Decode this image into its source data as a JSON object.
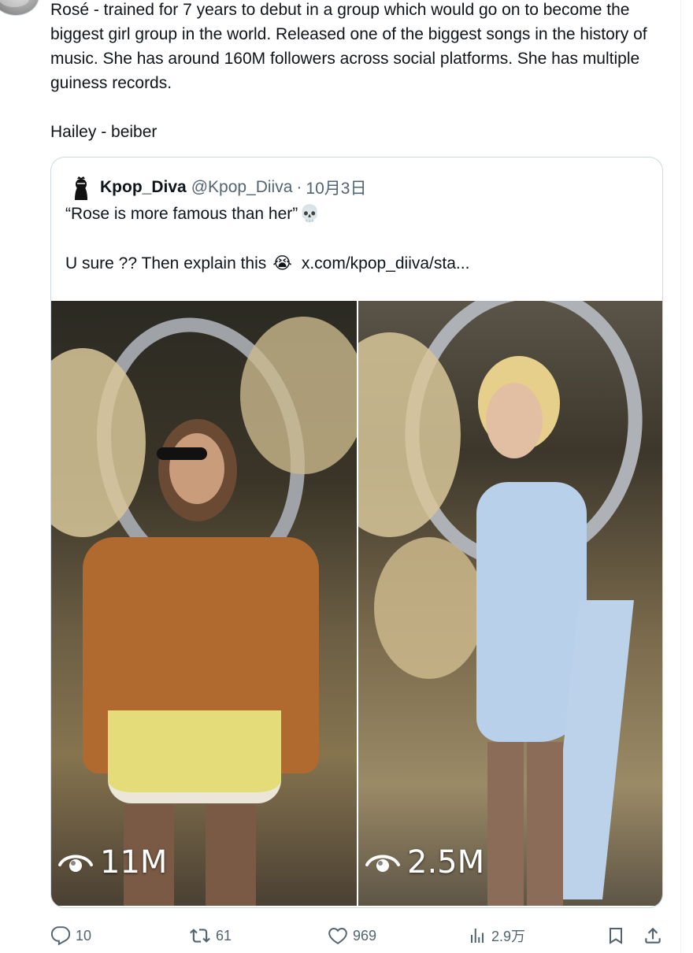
{
  "tweet": {
    "text_para1": "Rosé - trained for 7 years to debut in a group which would go on to become the biggest girl group in the world. Released one of the biggest songs in the history of music. She has around 160M followers across social platforms. She has multiple guiness records.",
    "text_para2": "Hailey - beiber"
  },
  "quoted_tweet": {
    "display_name": "Kpop_Diva",
    "handle": "@Kpop_Diiva",
    "separator": "·",
    "date": "10月3日",
    "line1": "“Rose is more famous than her”",
    "line1_emoji": "💀",
    "line2": "U sure ?? Then explain this",
    "line2_emoji": "😭",
    "link": "x.com/kpop_diiva/sta...",
    "media": [
      {
        "view_count": "11M",
        "icon": "eye-icon"
      },
      {
        "view_count": "2.5M",
        "icon": "eye-icon"
      }
    ]
  },
  "actions": {
    "replies": "10",
    "reposts": "61",
    "likes": "969",
    "views": "2.9万"
  },
  "colors": {
    "text": "#0f1419",
    "secondary": "#536471",
    "border": "#cfd9de"
  }
}
